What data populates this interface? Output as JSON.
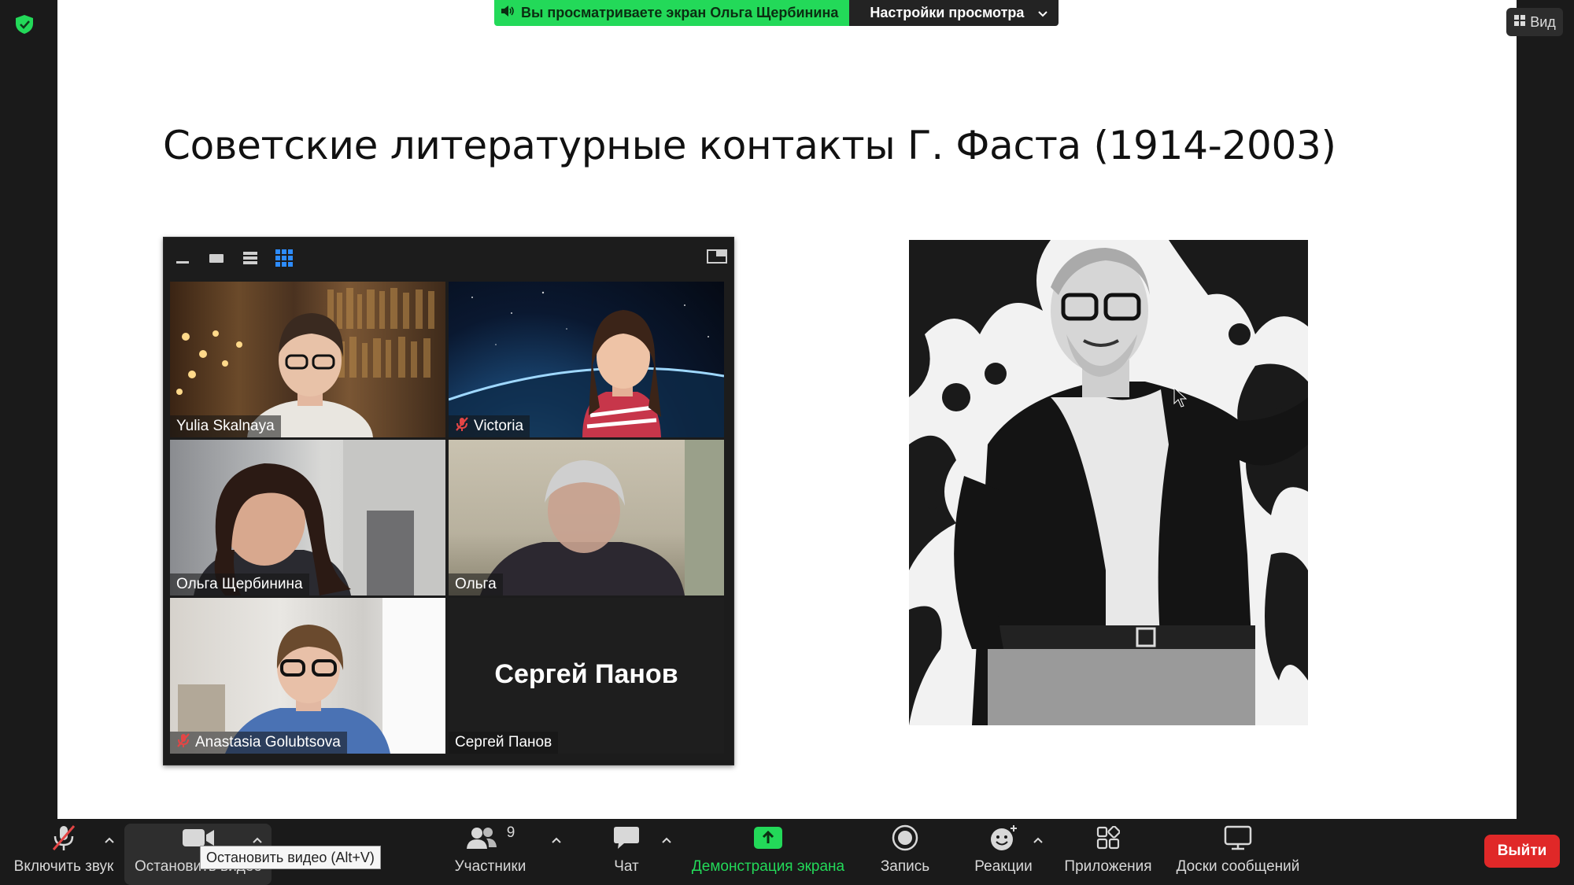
{
  "banner": {
    "sharing_text": "Вы просматриваете экран Ольга Щербинина",
    "view_options": "Настройки просмотра"
  },
  "view_button": {
    "label": "Вид"
  },
  "slide": {
    "title": "Советские литературные контакты  Г. Фаста (1914-2003)"
  },
  "gallery": {
    "tiles": [
      {
        "name": "Yulia Skalnaya",
        "muted": false
      },
      {
        "name": "Victoria",
        "muted": true
      },
      {
        "name": "Ольга Щербинина",
        "muted": false,
        "active": true
      },
      {
        "name": "Ольга",
        "muted": false
      },
      {
        "name": "Anastasia Golubtsova",
        "muted": true
      },
      {
        "name": "Сергей Панов",
        "muted": false,
        "video_off": true
      }
    ]
  },
  "toolbar": {
    "unmute": "Включить звук",
    "stop_video": "Остановить видео",
    "participants": "Участники",
    "participants_count": "9",
    "chat": "Чат",
    "share_screen": "Демонстрация экрана",
    "record": "Запись",
    "reactions": "Реакции",
    "apps": "Приложения",
    "whiteboards": "Доски сообщений",
    "leave": "Выйти"
  },
  "tooltip": {
    "text": "Остановить видео (Alt+V)"
  },
  "colors": {
    "accent_green": "#23d959",
    "leave_red": "#e02828",
    "active_speaker": "#e9e29b",
    "toolbar_bg": "#1a1a1a"
  }
}
